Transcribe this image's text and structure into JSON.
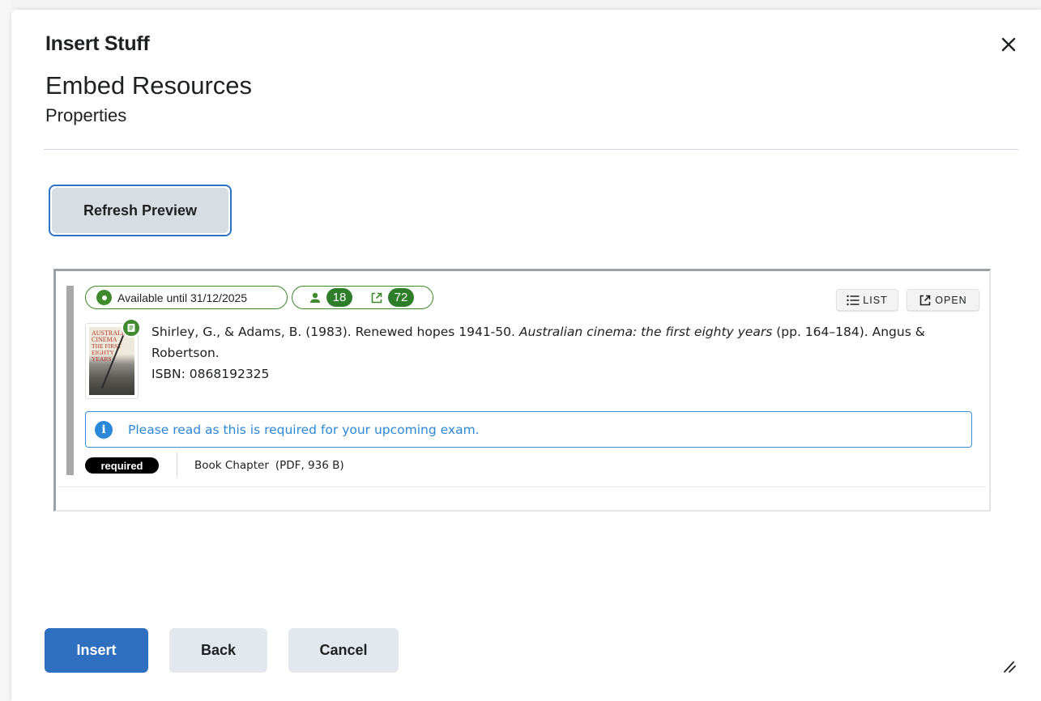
{
  "modal": {
    "title": "Insert Stuff",
    "heading": "Embed Resources",
    "subheading": "Properties",
    "close_icon": "close-icon"
  },
  "actions": {
    "refresh_label": "Refresh Preview"
  },
  "resource": {
    "availability": "Available until 31/12/2025",
    "student_count": "18",
    "open_count": "72",
    "list_label": "LIST",
    "open_label": "OPEN",
    "citation_authors": "Shirley, G., & Adams, B. (1983). Renewed hopes 1941-50.",
    "citation_source": "Australian cinema: the first eighty years",
    "citation_rest": "(pp. 164–184). Angus & Robertson.",
    "isbn": "ISBN: 0868192325",
    "cover_title_1": "AUSTRALIA CINEMA",
    "cover_title_2": "THE FIRST EIGHTY YEARS",
    "notice": "Please read as this is required for your upcoming exam.",
    "tag": "required",
    "type": "Book Chapter",
    "file_info": "(PDF, 936 B)"
  },
  "footer": {
    "insert_label": "Insert",
    "back_label": "Back",
    "cancel_label": "Cancel"
  },
  "colors": {
    "primary": "#2f6fbf",
    "success": "#3e8a2d",
    "info": "#2b88d8",
    "secondary_button": "#e3e7ee"
  }
}
